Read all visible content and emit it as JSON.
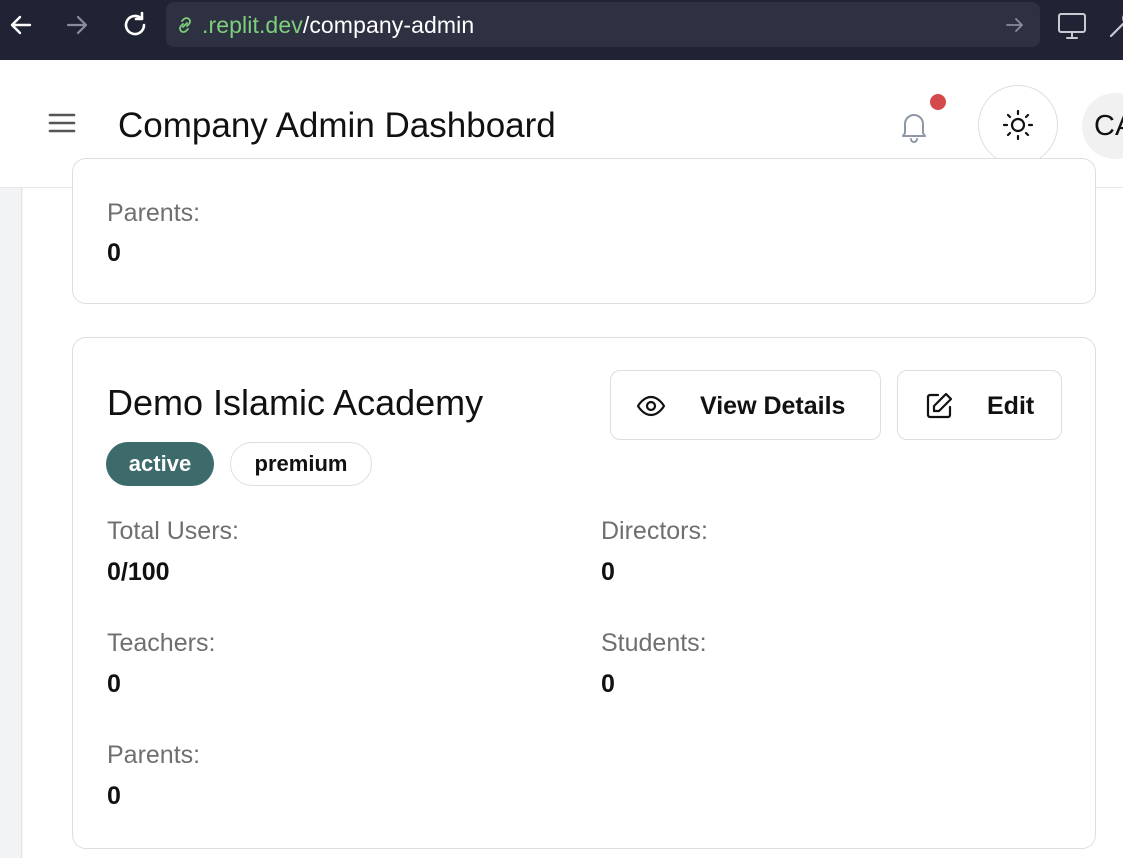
{
  "browser": {
    "url_host": ".replit.dev",
    "url_path": "/company-admin",
    "icons": [
      "back-icon",
      "forward-icon",
      "reload-icon",
      "link-icon",
      "go-arrow-icon",
      "monitor-icon",
      "wrench-icon"
    ]
  },
  "header": {
    "title": "Company Admin Dashboard",
    "avatar_initials": "CA",
    "notification_dot_color": "#d44a4a"
  },
  "previous_card": {
    "parents_label": "Parents:",
    "parents_value": "0"
  },
  "organization": {
    "name": "Demo Islamic Academy",
    "status_badge": "active",
    "plan_badge": "premium",
    "status_color": "#3d6b6c",
    "view_details_label": "View Details",
    "edit_label": "Edit",
    "stats": {
      "total_users_label": "Total Users:",
      "total_users_value": "0/100",
      "directors_label": "Directors:",
      "directors_value": "0",
      "teachers_label": "Teachers:",
      "teachers_value": "0",
      "students_label": "Students:",
      "students_value": "0",
      "parents_label": "Parents:",
      "parents_value": "0"
    }
  }
}
